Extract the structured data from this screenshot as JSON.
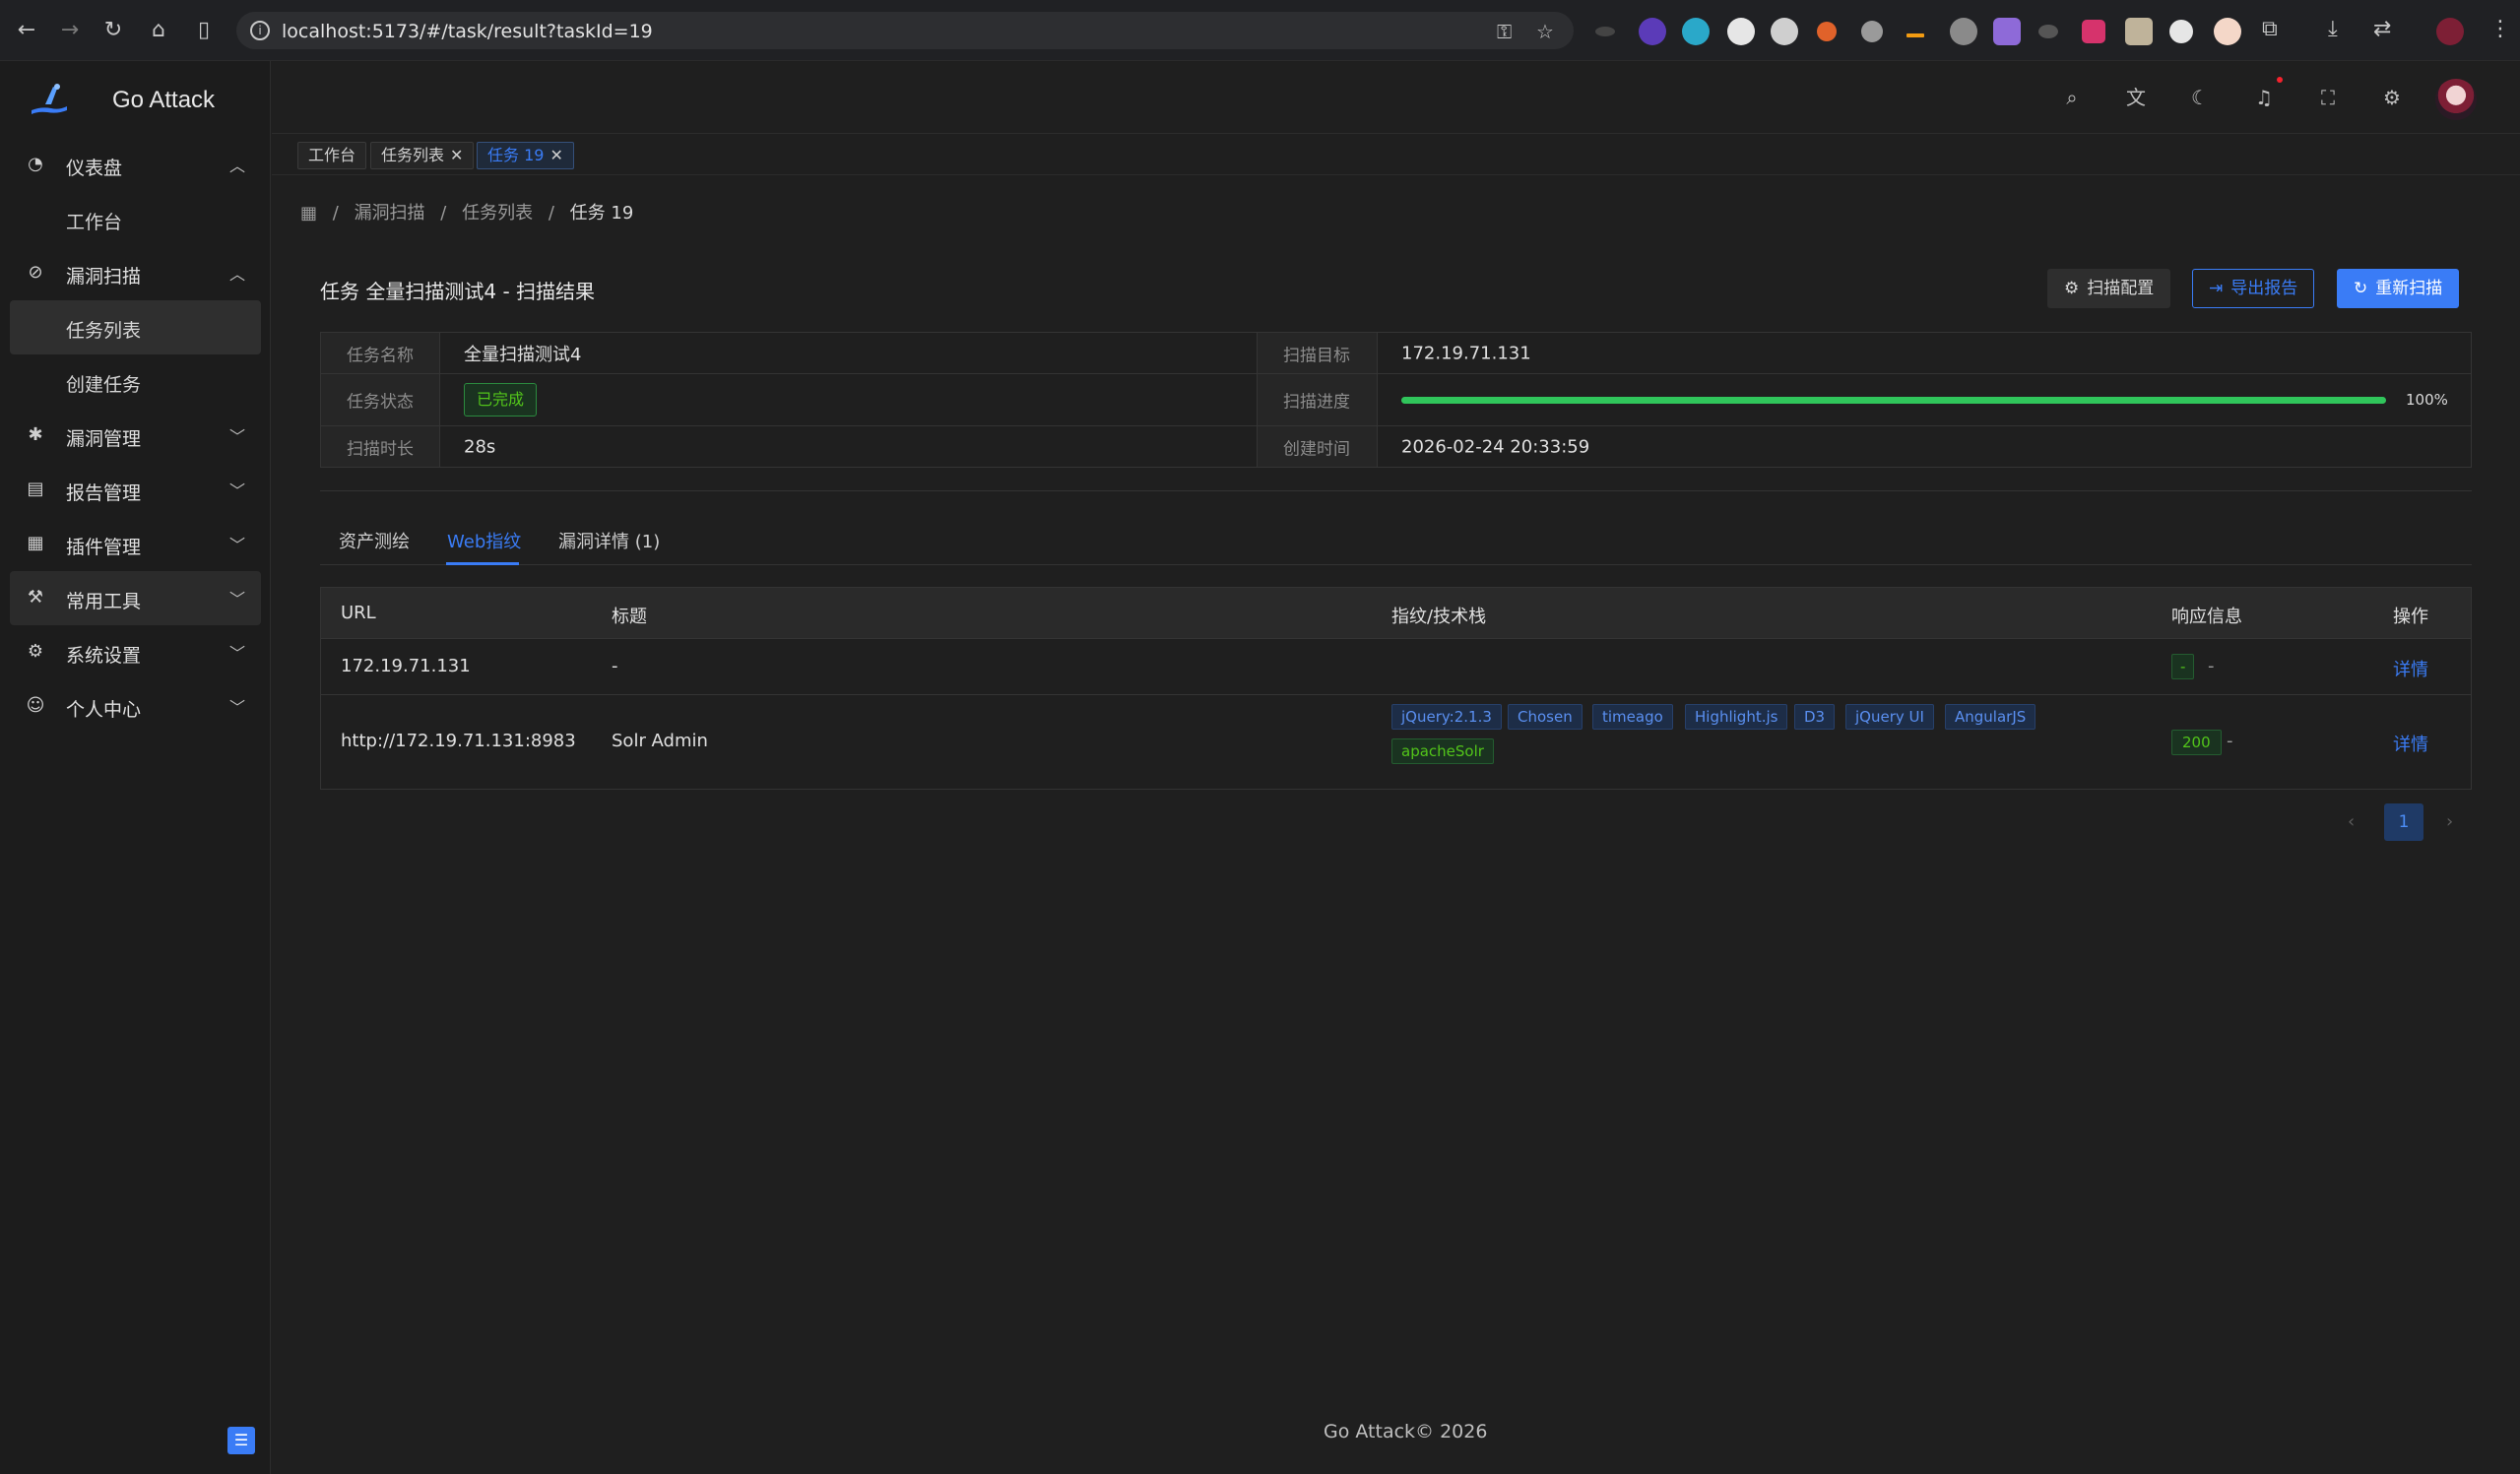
{
  "browser": {
    "url": "localhost:5173/#/task/result?taskId=19"
  },
  "app": {
    "name": "Go Attack",
    "footer": "Go Attack© 2026"
  },
  "sidebar": {
    "items": [
      {
        "label": "仪表盘",
        "icon": "dashboard-icon",
        "expanded": true
      },
      {
        "label": "工作台",
        "sub": true
      },
      {
        "label": "漏洞扫描",
        "icon": "scan-icon",
        "expanded": true
      },
      {
        "label": "任务列表",
        "sub": true,
        "active": true
      },
      {
        "label": "创建任务",
        "sub": true
      },
      {
        "label": "漏洞管理",
        "icon": "bug-icon"
      },
      {
        "label": "报告管理",
        "icon": "report-icon"
      },
      {
        "label": "插件管理",
        "icon": "plugin-icon"
      },
      {
        "label": "常用工具",
        "icon": "tool-icon"
      },
      {
        "label": "系统设置",
        "icon": "settings-icon"
      },
      {
        "label": "个人中心",
        "icon": "user-icon"
      }
    ]
  },
  "tabs": [
    {
      "label": "工作台"
    },
    {
      "label": "任务列表"
    },
    {
      "label": "任务 19"
    }
  ],
  "breadcrumb": [
    "漏洞扫描",
    "任务列表",
    "任务 19"
  ],
  "page": {
    "title": "任务 全量扫描测试4 - 扫描结果",
    "buttons": {
      "config": "扫描配置",
      "export": "导出报告",
      "rescan": "重新扫描"
    }
  },
  "details": {
    "task_name_label": "任务名称",
    "task_name": "全量扫描测试4",
    "target_label": "扫描目标",
    "target": "172.19.71.131",
    "status_label": "任务状态",
    "status": "已完成",
    "progress_label": "扫描进度",
    "progress_text": "100%",
    "progress": 1.0,
    "duration_label": "扫描时长",
    "duration": "28s",
    "created_label": "创建时间",
    "created": "2026-02-24 20:33:59"
  },
  "content_tabs": [
    {
      "label": "资产测绘"
    },
    {
      "label": "Web指纹",
      "active": true
    },
    {
      "label": "漏洞详情 (1)"
    }
  ],
  "table": {
    "headers": [
      "URL",
      "标题",
      "指纹/技术栈",
      "响应信息",
      "操作"
    ],
    "rows": [
      {
        "url": "172.19.71.131",
        "title": "-",
        "tags": [],
        "code": "-",
        "resp_extra": "-",
        "action": "详情"
      },
      {
        "url": "http://172.19.71.131:8983",
        "title": "Solr Admin",
        "tags": [
          "jQuery:2.1.3",
          "Chosen",
          "timeago",
          "Highlight.js",
          "D3",
          "jQuery UI",
          "AngularJS",
          "apacheSolr"
        ],
        "code": "200",
        "resp_extra": "-",
        "action": "详情"
      }
    ]
  },
  "pagination": {
    "current": "1",
    "prev": "‹",
    "next": "›"
  },
  "colors": {
    "accent": "#3a7cf6",
    "success": "#52c41a",
    "progress": "#30c55b"
  }
}
